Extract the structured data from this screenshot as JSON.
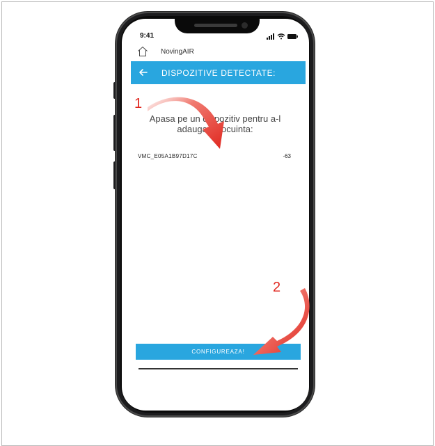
{
  "status_bar": {
    "time": "9:41",
    "icons": [
      "signal-icon",
      "wifi-icon",
      "battery-icon"
    ]
  },
  "app": {
    "name": "NovingAIR",
    "home_icon": "home-icon"
  },
  "title_bar": {
    "title": "DISPOZITIVE DETECTATE:",
    "back_icon": "back-arrow-icon"
  },
  "instruction": {
    "line1": "Apasa pe un dispozitiv pentru a-l",
    "line2": "adauga la locuinta:"
  },
  "devices": [
    {
      "name": "VMC_E05A1B97D17C",
      "rssi": "-63"
    }
  ],
  "configure_button": {
    "label": "CONFIGUREAZA!"
  },
  "annotations": {
    "step1": "1",
    "step2": "2",
    "arrow_color": "#e0271f"
  },
  "colors": {
    "accent": "#29a6df",
    "phone_body": "#1c1c1e"
  }
}
